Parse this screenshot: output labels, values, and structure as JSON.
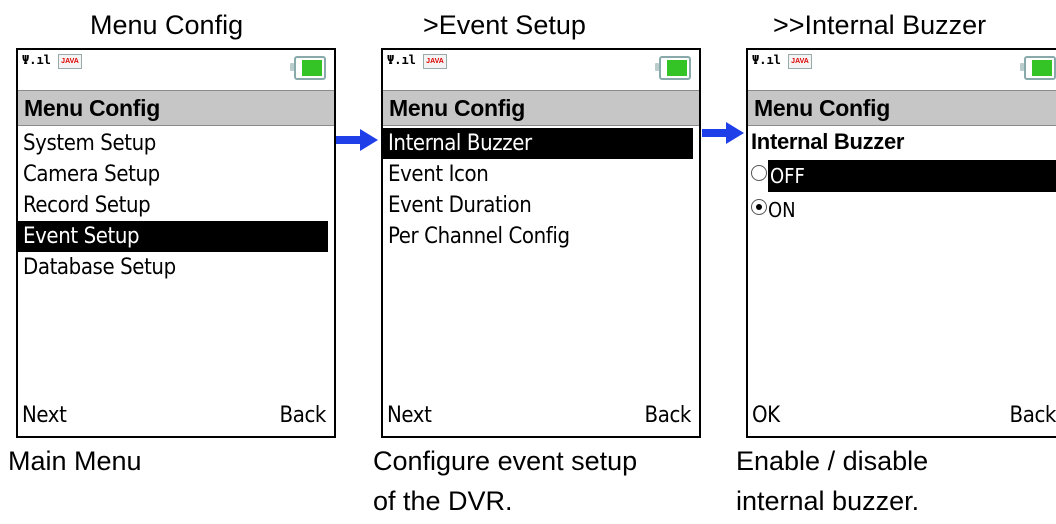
{
  "headings": [
    "Menu Config",
    ">Event Setup",
    ">>Internal Buzzer"
  ],
  "phone1": {
    "title": "Menu Config",
    "items": [
      "System Setup",
      "Camera Setup",
      "Record Setup",
      "Event Setup",
      "Database Setup"
    ],
    "selected": "Event Setup",
    "softkeys": {
      "left": "Next",
      "right": "Back"
    }
  },
  "phone2": {
    "title": "Menu Config",
    "items": [
      "Internal Buzzer",
      "Event Icon",
      "Event Duration",
      "Per Channel Config"
    ],
    "selected": "Internal Buzzer",
    "softkeys": {
      "left": "Next",
      "right": "Back"
    }
  },
  "phone3": {
    "title": "Menu Config",
    "field_label": "Internal Buzzer",
    "options": [
      {
        "label": "OFF",
        "checked": false,
        "highlighted": true
      },
      {
        "label": "ON",
        "checked": true,
        "highlighted": false
      }
    ],
    "softkeys": {
      "left": "OK",
      "right": "Back"
    }
  },
  "status_bar": {
    "java_label": "JAVA",
    "signal_icon": "signal-icon",
    "battery_icon": "battery-icon"
  },
  "captions": {
    "c1": "Main Menu",
    "c2_line1": "Configure event setup",
    "c2_line2": "of the DVR.",
    "c3_line1": "Enable / disable",
    "c3_line2": "internal buzzer."
  },
  "colors": {
    "arrow": "#1f3fe8",
    "selection": "#000000",
    "titlebar": "#c6c6c6",
    "battery": "#35c425"
  }
}
